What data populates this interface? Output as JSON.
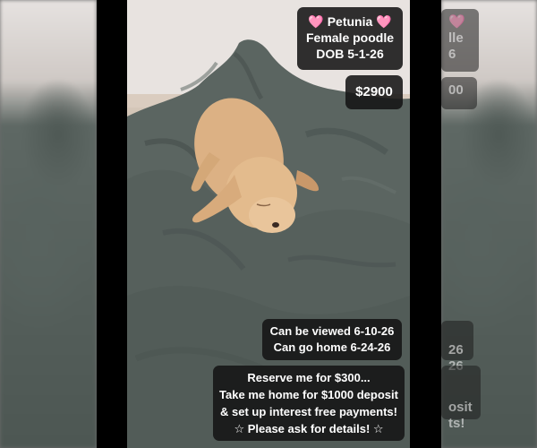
{
  "captions": {
    "name": "🩷 Petunia 🩷\nFemale poodle\nDOB 5-1-26",
    "price": "$2900",
    "viewing": "Can be viewed 6-10-26\nCan go home 6-24-26",
    "reserve": "Reserve me for $300...\nTake me home for $1000 deposit\n& set up interest free payments!\n☆ Please ask for details! ☆"
  },
  "ghost_fragments": {
    "heart": "🩷",
    "name_tail": "lle",
    "dob_tail": "6",
    "price_tail": "00",
    "viewed_tail": "26\n26",
    "reserve_tail": "osit\nts!"
  },
  "colors": {
    "blanket": "#58625e",
    "puppy": "#e2b98a",
    "caption_bg": "#141414"
  }
}
